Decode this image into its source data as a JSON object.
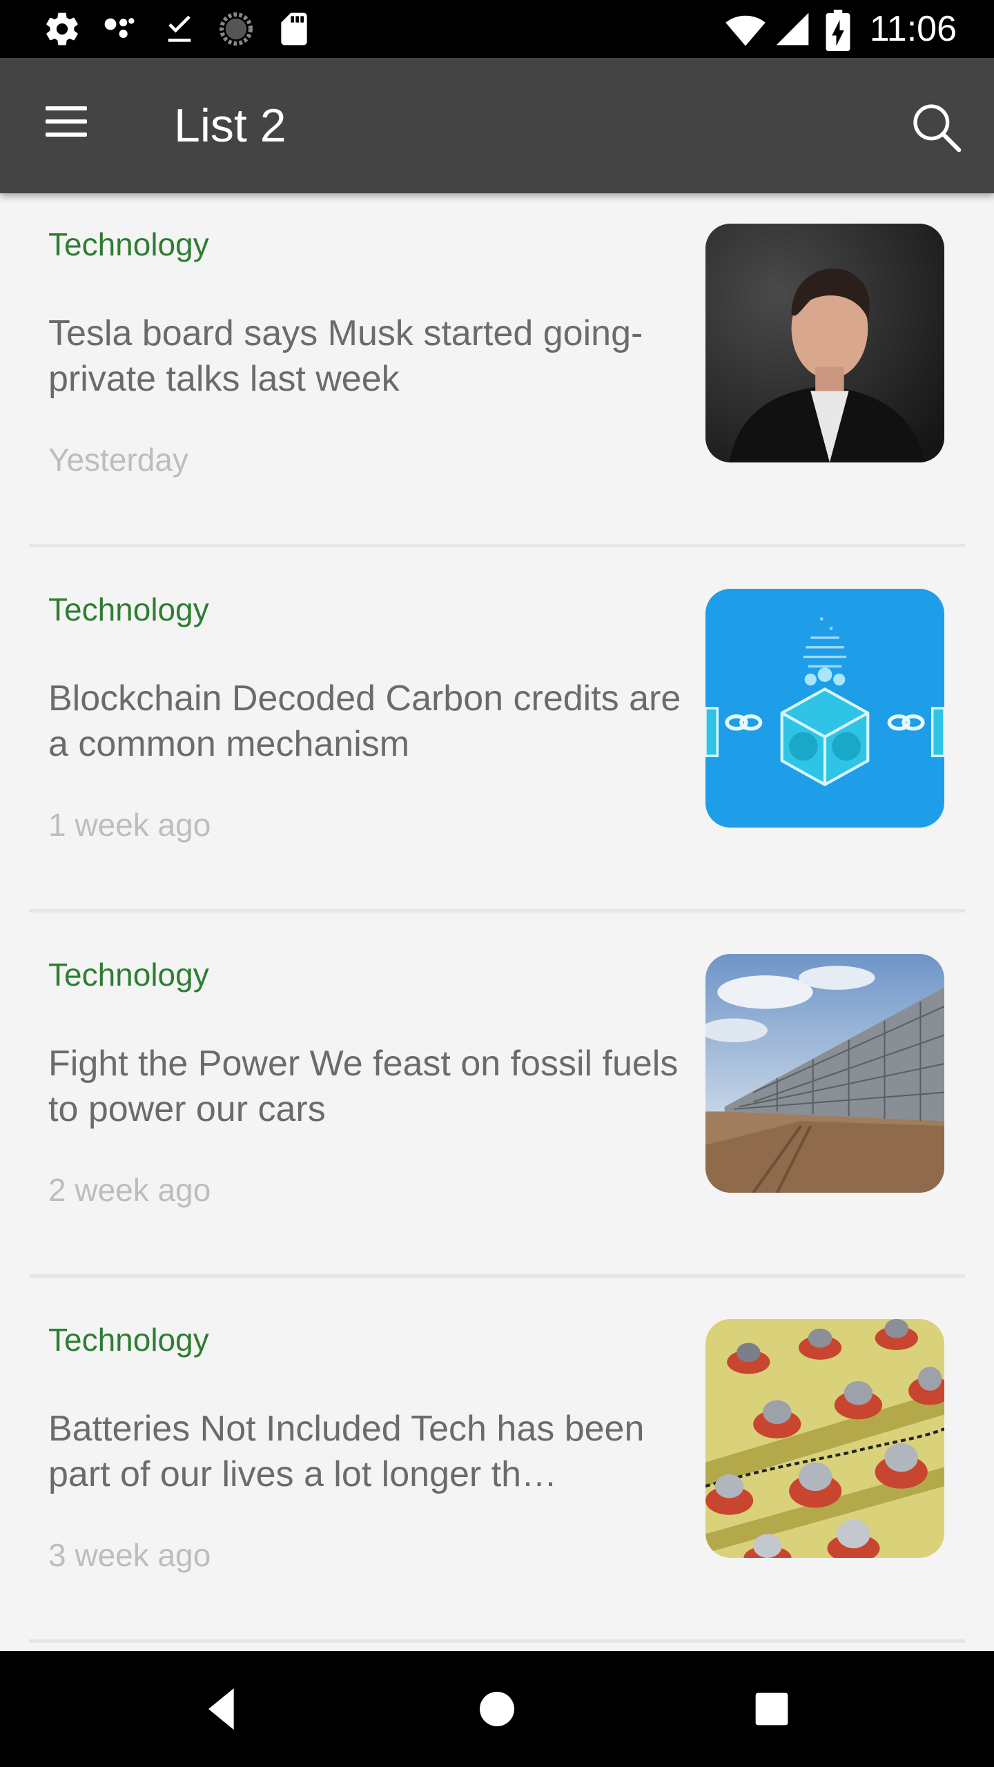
{
  "status_bar": {
    "time": "11:06",
    "left_icons": [
      "settings-icon",
      "assistant-dots-icon",
      "download-done-icon",
      "sync-progress-icon",
      "sd-card-icon"
    ],
    "right_icons": [
      "wifi-icon",
      "cell-signal-icon",
      "battery-charging-icon"
    ]
  },
  "app_bar": {
    "title": "List 2",
    "menu_icon": "hamburger-menu-icon",
    "search_icon": "search-icon",
    "background": "#444444"
  },
  "articles": [
    {
      "category": "Technology",
      "headline": "Tesla board says Musk started going-private talks last week",
      "time": "Yesterday",
      "image": "portrait-photo"
    },
    {
      "category": "Technology",
      "headline": "Blockchain Decoded Carbon credits are a common mechanism",
      "time": "1 week ago",
      "image": "blockchain-illustration"
    },
    {
      "category": "Technology",
      "headline": "Fight the Power We feast on fossil fuels to power our cars",
      "time": "2 week ago",
      "image": "carbon-capture-plant-photo"
    },
    {
      "category": "Technology",
      "headline": "Batteries Not Included Tech has been part of our lives a lot longer th…",
      "time": "3 week ago",
      "image": "battery-cells-photo"
    }
  ],
  "colors": {
    "category": "#2e7d32",
    "headline": "#6b6b6b",
    "timestamp": "#bdbdbd",
    "background": "#f4f4f4"
  },
  "nav_bar": {
    "buttons": [
      "back-icon",
      "home-icon",
      "recents-icon"
    ]
  }
}
